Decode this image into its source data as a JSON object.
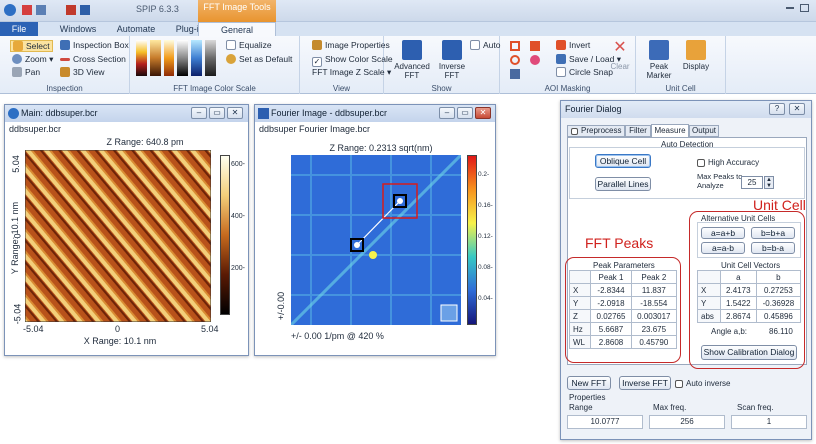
{
  "app": {
    "title": "SPIP 6.3.3",
    "context_tab": "FFT Image Tools"
  },
  "tabs": [
    "File",
    "Windows",
    "Automate",
    "Plug-ins",
    "General"
  ],
  "ribbon": {
    "inspection": {
      "label": "Inspection",
      "select": "Select",
      "zoom": "Zoom",
      "pan": "Pan",
      "inspection_box": "Inspection Box",
      "cross_section": "Cross Section",
      "view3d": "3D View"
    },
    "colorscale": {
      "label": "FFT Image Color Scale",
      "equalize": "Equalize",
      "set_default": "Set as Default"
    },
    "view": {
      "label": "View",
      "image_properties": "Image Properties",
      "show_color_scale": "Show Color Scale",
      "fft_zscale": "FFT Image Z Scale"
    },
    "show": {
      "label": "Show",
      "advanced_fft": "Advanced FFT",
      "inverse_fft": "Inverse FFT",
      "auto": "Auto"
    },
    "aoi": {
      "label": "AOI Masking",
      "invert": "Invert",
      "save_load": "Save / Load",
      "circle_snap": "Circle Snap",
      "clear": "Clear"
    },
    "unitcell": {
      "label": "Unit Cell",
      "peak_marker": "Peak Marker",
      "display": "Display"
    }
  },
  "main_window": {
    "title": "Main: ddbsuper.bcr",
    "subtitle": "ddbsuper.bcr",
    "zrange": "Z Range:  640.8 pm",
    "ylabel": "Y Range: 10.1 nm",
    "xlabel": "X Range:  10.1 nm",
    "xticks": [
      "-5.04",
      "0",
      "5.04"
    ],
    "yticks": [
      "5.04",
      "0",
      "-5.04"
    ],
    "cticks": [
      "600-",
      "400-",
      "200-"
    ]
  },
  "fourier_window": {
    "title": "Fourier Image - ddbsuper.bcr",
    "subtitle": "ddbsuper Fourier Image.bcr",
    "zrange": "Z Range:  0.2313 sqrt(nm)",
    "footer": "+/- 0.00 1/pm @ 420 %",
    "yaxis": "+/-0.00",
    "cticks": [
      "0.2-",
      "0.16-",
      "0.12-",
      "0.08-",
      "0.04-"
    ]
  },
  "dialog": {
    "title": "Fourier Dialog",
    "tabs": [
      "Preprocess",
      "Filter",
      "Measure",
      "Output"
    ],
    "auto_detection": "Auto Detection",
    "oblique_cell": "Oblique Cell",
    "parallel_lines": "Parallel Lines",
    "high_accuracy": "High Accuracy",
    "max_peaks_label": "Max Peaks to Analyze",
    "max_peaks": "25",
    "annotation_fft": "FFT Peaks",
    "annotation_unit": "Unit Cell",
    "alt_cells": "Alternative Unit Cells",
    "cell_buttons": [
      "a=a+b",
      "b=b+a",
      "a=a-b",
      "b=b-a"
    ],
    "peak_params": {
      "title": "Peak Parameters",
      "headers": [
        "",
        "Peak 1",
        "Peak 2"
      ],
      "rows": [
        [
          "X",
          "-2.8344",
          "11.837"
        ],
        [
          "Y",
          "-2.0918",
          "-18.554"
        ],
        [
          "Z",
          "0.02765",
          "0.003017"
        ],
        [
          "Hz",
          "5.6687",
          "23.675"
        ],
        [
          "WL",
          "2.8608",
          "0.45790"
        ]
      ]
    },
    "vectors": {
      "title": "Unit Cell Vectors",
      "headers": [
        "",
        "a",
        "b"
      ],
      "rows": [
        [
          "X",
          "2.4173",
          "0.27253"
        ],
        [
          "Y",
          "1.5422",
          "-0.36928"
        ],
        [
          "abs",
          "2.8674",
          "0.45896"
        ]
      ],
      "angle_label": "Angle a,b:",
      "angle": "86.110"
    },
    "show_calibration": "Show Calibration Dialog",
    "new_fft": "New FFT",
    "inverse_fft": "Inverse FFT",
    "auto_inverse": "Auto inverse",
    "properties": "Properties",
    "prop_headers": [
      "Range",
      "Max freq.",
      "Scan freq."
    ],
    "prop_values": [
      "10.0777",
      "256",
      "1"
    ]
  }
}
